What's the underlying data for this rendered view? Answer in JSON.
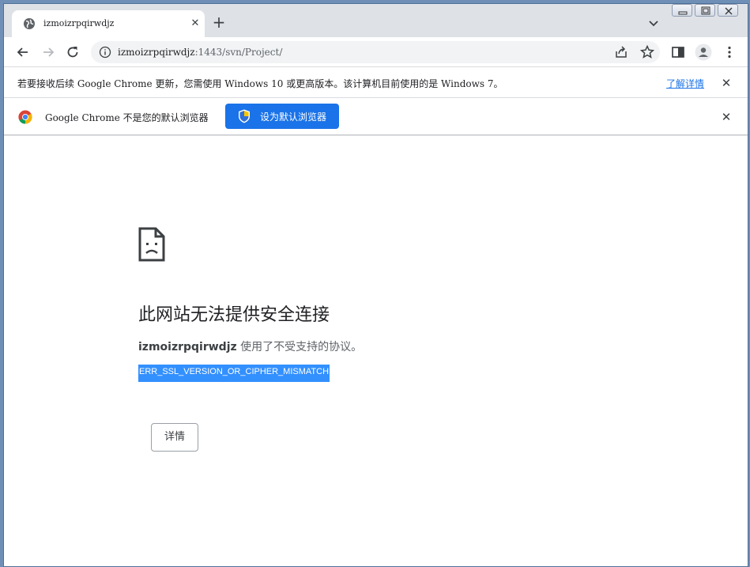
{
  "tab": {
    "title": "izmoizrpqirwdjz",
    "close": "✕",
    "new_tab": "+"
  },
  "toolbar": {
    "url_host": "izmoizrpqirwdjz",
    "url_rest": ":1443/svn/Project/"
  },
  "infobar_update": {
    "text": "若要接收后续 Google Chrome 更新，您需使用 Windows 10 或更高版本。该计算机目前使用的是 Windows 7。",
    "link": "了解详情",
    "close": "✕"
  },
  "infobar_default": {
    "text": "Google Chrome 不是您的默认浏览器",
    "button": "设为默认浏览器",
    "close": "✕"
  },
  "error": {
    "heading": "此网站无法提供安全连接",
    "host": "izmoizrpqirwdjz",
    "message": " 使用了不受支持的协议。",
    "code": "ERR_SSL_VERSION_OR_CIPHER_MISMATCH",
    "details_button": "详情"
  },
  "colors": {
    "accent": "#1a73e8",
    "selection": "#3390ff",
    "tabstrip": "#dee1e6"
  }
}
